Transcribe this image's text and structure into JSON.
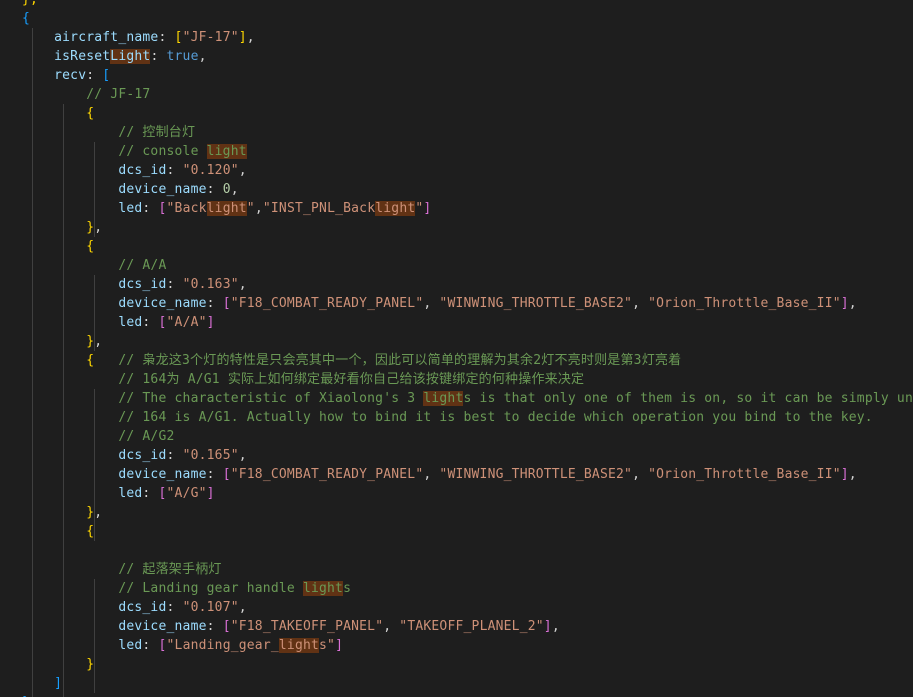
{
  "colors": {
    "background": "#1e1e1e",
    "default_text": "#d4d4d4",
    "property_key": "#9cdcfe",
    "string": "#ce9178",
    "number": "#b5cea8",
    "keyword": "#569cd6",
    "comment": "#6a9955",
    "bracket_gold": "#ffd700",
    "bracket_orchid": "#da70d6",
    "bracket_blue": "#179fff",
    "find_match_highlight": "#613214",
    "indent_guide": "#404040"
  },
  "search_term": "light",
  "editor": {
    "lines": [
      [
        {
          "t": "},",
          "c": "b1"
        }
      ],
      [
        {
          "t": "{",
          "c": "b3"
        }
      ],
      [
        {
          "t": "    ",
          "c": "p"
        },
        {
          "t": "aircraft_name",
          "c": "key"
        },
        {
          "t": ": ",
          "c": "p"
        },
        {
          "t": "[",
          "c": "b1"
        },
        {
          "t": "\"JF-17\"",
          "c": "str"
        },
        {
          "t": "]",
          "c": "b1"
        },
        {
          "t": ",",
          "c": "p"
        }
      ],
      [
        {
          "t": "    ",
          "c": "p"
        },
        {
          "t": "isReset",
          "c": "key"
        },
        {
          "t": "Light",
          "c": "key",
          "hl": true
        },
        {
          "t": ": ",
          "c": "p"
        },
        {
          "t": "true",
          "c": "kw"
        },
        {
          "t": ",",
          "c": "p"
        }
      ],
      [
        {
          "t": "    ",
          "c": "p"
        },
        {
          "t": "recv",
          "c": "key"
        },
        {
          "t": ": ",
          "c": "p"
        },
        {
          "t": "[",
          "c": "b3"
        }
      ],
      [
        {
          "t": "        ",
          "c": "p"
        },
        {
          "t": "// JF-17",
          "c": "cmt"
        }
      ],
      [
        {
          "t": "        ",
          "c": "p"
        },
        {
          "t": "{",
          "c": "b1"
        }
      ],
      [
        {
          "t": "            ",
          "c": "p"
        },
        {
          "t": "// 控制台灯",
          "c": "cmt"
        }
      ],
      [
        {
          "t": "            ",
          "c": "p"
        },
        {
          "t": "// console ",
          "c": "cmt"
        },
        {
          "t": "light",
          "c": "cmt",
          "hl": true
        }
      ],
      [
        {
          "t": "            ",
          "c": "p"
        },
        {
          "t": "dcs_id",
          "c": "key"
        },
        {
          "t": ": ",
          "c": "p"
        },
        {
          "t": "\"0.120\"",
          "c": "str"
        },
        {
          "t": ",",
          "c": "p"
        }
      ],
      [
        {
          "t": "            ",
          "c": "p"
        },
        {
          "t": "device_name",
          "c": "key"
        },
        {
          "t": ": ",
          "c": "p"
        },
        {
          "t": "0",
          "c": "num"
        },
        {
          "t": ",",
          "c": "p"
        }
      ],
      [
        {
          "t": "            ",
          "c": "p"
        },
        {
          "t": "led",
          "c": "key"
        },
        {
          "t": ": ",
          "c": "p"
        },
        {
          "t": "[",
          "c": "b2"
        },
        {
          "t": "\"Back",
          "c": "str"
        },
        {
          "t": "light",
          "c": "str",
          "hl": true
        },
        {
          "t": "\"",
          "c": "str"
        },
        {
          "t": ",",
          "c": "p"
        },
        {
          "t": "\"INST_PNL_Back",
          "c": "str"
        },
        {
          "t": "light",
          "c": "str",
          "hl": true
        },
        {
          "t": "\"",
          "c": "str"
        },
        {
          "t": "]",
          "c": "b2"
        }
      ],
      [
        {
          "t": "        ",
          "c": "p"
        },
        {
          "t": "}",
          "c": "b1"
        },
        {
          "t": ",",
          "c": "p"
        }
      ],
      [
        {
          "t": "        ",
          "c": "p"
        },
        {
          "t": "{",
          "c": "b1"
        }
      ],
      [
        {
          "t": "            ",
          "c": "p"
        },
        {
          "t": "// A/A",
          "c": "cmt"
        }
      ],
      [
        {
          "t": "            ",
          "c": "p"
        },
        {
          "t": "dcs_id",
          "c": "key"
        },
        {
          "t": ": ",
          "c": "p"
        },
        {
          "t": "\"0.163\"",
          "c": "str"
        },
        {
          "t": ",",
          "c": "p"
        }
      ],
      [
        {
          "t": "            ",
          "c": "p"
        },
        {
          "t": "device_name",
          "c": "key"
        },
        {
          "t": ": ",
          "c": "p"
        },
        {
          "t": "[",
          "c": "b2"
        },
        {
          "t": "\"F18_COMBAT_READY_PANEL\"",
          "c": "str"
        },
        {
          "t": ", ",
          "c": "p"
        },
        {
          "t": "\"WINWING_THROTTLE_BASE2\"",
          "c": "str"
        },
        {
          "t": ", ",
          "c": "p"
        },
        {
          "t": "\"Orion_Throttle_Base_II\"",
          "c": "str"
        },
        {
          "t": "]",
          "c": "b2"
        },
        {
          "t": ",",
          "c": "p"
        }
      ],
      [
        {
          "t": "            ",
          "c": "p"
        },
        {
          "t": "led",
          "c": "key"
        },
        {
          "t": ": ",
          "c": "p"
        },
        {
          "t": "[",
          "c": "b2"
        },
        {
          "t": "\"A/A\"",
          "c": "str"
        },
        {
          "t": "]",
          "c": "b2"
        }
      ],
      [
        {
          "t": "        ",
          "c": "p"
        },
        {
          "t": "}",
          "c": "b1"
        },
        {
          "t": ",",
          "c": "p"
        }
      ],
      [
        {
          "t": "        ",
          "c": "p"
        },
        {
          "t": "{",
          "c": "b1"
        },
        {
          "t": "   ",
          "c": "p"
        },
        {
          "t": "// 枭龙这3个灯的特性是只会亮其中一个，因此可以简单的理解为其余2灯不亮时则是第3灯亮着",
          "c": "cmt"
        }
      ],
      [
        {
          "t": "            ",
          "c": "p"
        },
        {
          "t": "// 164为 A/G1 实际上如何绑定最好看你自己给该按键绑定的何种操作来决定",
          "c": "cmt"
        }
      ],
      [
        {
          "t": "            ",
          "c": "p"
        },
        {
          "t": "// The characteristic of Xiaolong's 3 ",
          "c": "cmt"
        },
        {
          "t": "light",
          "c": "cmt",
          "hl": true
        },
        {
          "t": "s is that only one of them is on, so it can be simply underst",
          "c": "cmt"
        }
      ],
      [
        {
          "t": "            ",
          "c": "p"
        },
        {
          "t": "// 164 is A/G1. Actually how to bind it is best to decide which operation you bind to the key.",
          "c": "cmt"
        }
      ],
      [
        {
          "t": "            ",
          "c": "p"
        },
        {
          "t": "// A/G2",
          "c": "cmt"
        }
      ],
      [
        {
          "t": "            ",
          "c": "p"
        },
        {
          "t": "dcs_id",
          "c": "key"
        },
        {
          "t": ": ",
          "c": "p"
        },
        {
          "t": "\"0.165\"",
          "c": "str"
        },
        {
          "t": ",",
          "c": "p"
        }
      ],
      [
        {
          "t": "            ",
          "c": "p"
        },
        {
          "t": "device_name",
          "c": "key"
        },
        {
          "t": ": ",
          "c": "p"
        },
        {
          "t": "[",
          "c": "b2"
        },
        {
          "t": "\"F18_COMBAT_READY_PANEL\"",
          "c": "str"
        },
        {
          "t": ", ",
          "c": "p"
        },
        {
          "t": "\"WINWING_THROTTLE_BASE2\"",
          "c": "str"
        },
        {
          "t": ", ",
          "c": "p"
        },
        {
          "t": "\"Orion_Throttle_Base_II\"",
          "c": "str"
        },
        {
          "t": "]",
          "c": "b2"
        },
        {
          "t": ",",
          "c": "p"
        }
      ],
      [
        {
          "t": "            ",
          "c": "p"
        },
        {
          "t": "led",
          "c": "key"
        },
        {
          "t": ": ",
          "c": "p"
        },
        {
          "t": "[",
          "c": "b2"
        },
        {
          "t": "\"A/G\"",
          "c": "str"
        },
        {
          "t": "]",
          "c": "b2"
        }
      ],
      [
        {
          "t": "        ",
          "c": "p"
        },
        {
          "t": "}",
          "c": "b1"
        },
        {
          "t": ",",
          "c": "p"
        }
      ],
      [
        {
          "t": "        ",
          "c": "p"
        },
        {
          "t": "{",
          "c": "b1"
        }
      ],
      [],
      [
        {
          "t": "            ",
          "c": "p"
        },
        {
          "t": "// 起落架手柄灯",
          "c": "cmt"
        }
      ],
      [
        {
          "t": "            ",
          "c": "p"
        },
        {
          "t": "// Landing gear handle ",
          "c": "cmt"
        },
        {
          "t": "light",
          "c": "cmt",
          "hl": true
        },
        {
          "t": "s",
          "c": "cmt"
        }
      ],
      [
        {
          "t": "            ",
          "c": "p"
        },
        {
          "t": "dcs_id",
          "c": "key"
        },
        {
          "t": ": ",
          "c": "p"
        },
        {
          "t": "\"0.107\"",
          "c": "str"
        },
        {
          "t": ",",
          "c": "p"
        }
      ],
      [
        {
          "t": "            ",
          "c": "p"
        },
        {
          "t": "device_name",
          "c": "key"
        },
        {
          "t": ": ",
          "c": "p"
        },
        {
          "t": "[",
          "c": "b2"
        },
        {
          "t": "\"F18_TAKEOFF_PANEL\"",
          "c": "str"
        },
        {
          "t": ", ",
          "c": "p"
        },
        {
          "t": "\"TAKEOFF_PLANEL_2\"",
          "c": "str"
        },
        {
          "t": "]",
          "c": "b2"
        },
        {
          "t": ",",
          "c": "p"
        }
      ],
      [
        {
          "t": "            ",
          "c": "p"
        },
        {
          "t": "led",
          "c": "key"
        },
        {
          "t": ": ",
          "c": "p"
        },
        {
          "t": "[",
          "c": "b2"
        },
        {
          "t": "\"Landing_gear_",
          "c": "str"
        },
        {
          "t": "light",
          "c": "str",
          "hl": true
        },
        {
          "t": "s\"",
          "c": "str"
        },
        {
          "t": "]",
          "c": "b2"
        }
      ],
      [
        {
          "t": "        ",
          "c": "p"
        },
        {
          "t": "}",
          "c": "b1"
        }
      ],
      [
        {
          "t": "    ",
          "c": "p"
        },
        {
          "t": "]",
          "c": "b3"
        }
      ],
      [
        {
          "t": "},",
          "c": "b3"
        }
      ],
      [
        {
          "t": "{",
          "c": "b3"
        }
      ]
    ]
  }
}
